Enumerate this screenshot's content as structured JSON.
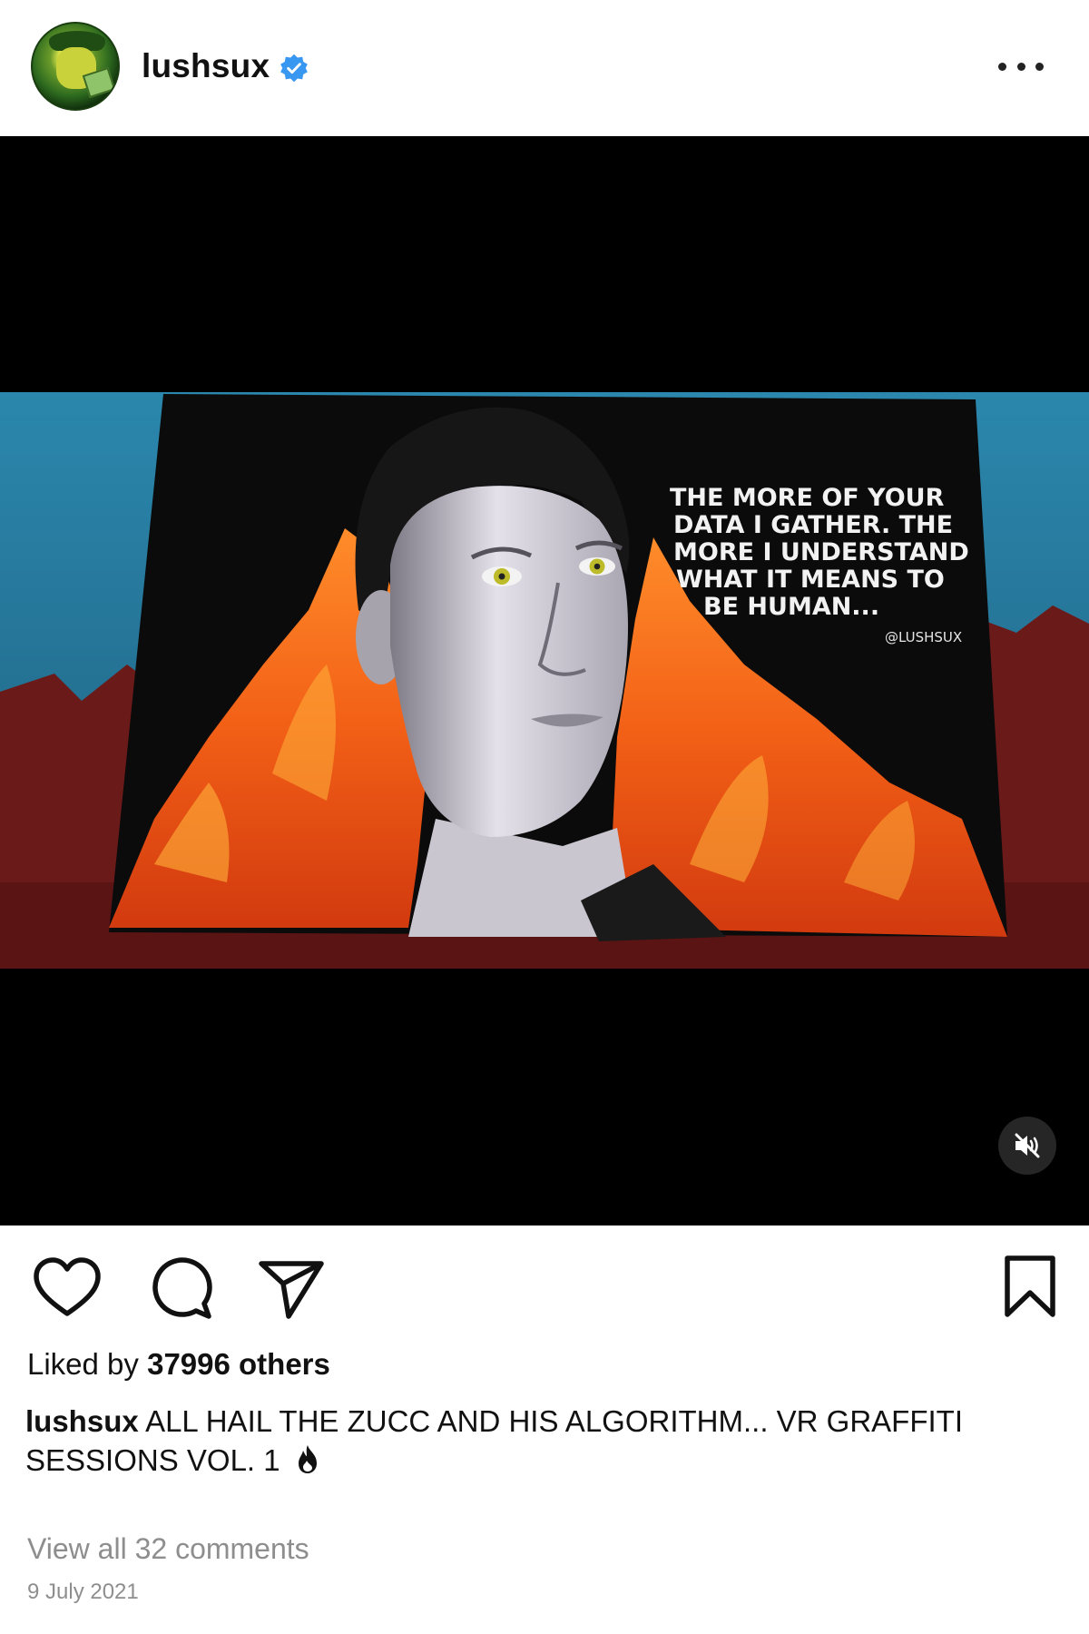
{
  "post": {
    "username": "lushsux",
    "verified": true,
    "caption_user": "lushsux",
    "caption_text": "ALL HAIL THE ZUCC AND HIS ALGORITHM... VR GRAFFITI SESSIONS VOL. 1",
    "caption_emoji": "fire-emoji",
    "likes_prefix": "Liked by ",
    "likes_count": "37996 others",
    "view_comments": "View all 32 comments",
    "date": "9 July 2021"
  },
  "media": {
    "type": "video",
    "muted": true,
    "artwork_text": "THE MORE OF YOUR DATA I GATHER. THE MORE I UNDERSTAND WHAT IT MEANS TO BE HUMAN...",
    "artwork_signature": "@LUSHSUX"
  },
  "icons": {
    "more": "more-options-icon",
    "like": "heart-icon",
    "comment": "comment-icon",
    "share": "share-icon",
    "save": "bookmark-icon",
    "mute": "speaker-muted-icon",
    "verified": "verified-badge-icon"
  },
  "colors": {
    "verified_blue": "#3897f0",
    "muted_text": "#8e8e8e",
    "flame_orange": "#f0631a",
    "sky_teal": "#2e8fb1"
  }
}
